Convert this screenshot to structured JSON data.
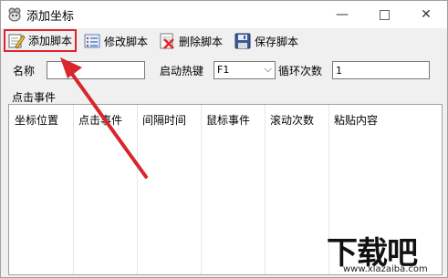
{
  "window": {
    "title": "添加坐标",
    "minimize": "—",
    "close": "✕"
  },
  "toolbar": {
    "add_label": "添加脚本",
    "edit_label": "修改脚本",
    "delete_label": "删除脚本",
    "save_label": "保存脚本"
  },
  "form": {
    "name_label": "名称",
    "name_value": "",
    "hotkey_label": "启动热键",
    "hotkey_value": "F1",
    "loop_label": "循环次数",
    "loop_value": "1"
  },
  "events": {
    "group_label": "点击事件",
    "columns": [
      "坐标位置",
      "点击事件",
      "间隔时间",
      "鼠标事件",
      "滚动次数",
      "粘贴内容"
    ]
  },
  "watermark": {
    "big": "下载吧",
    "url": "www.xiazaiba.com"
  },
  "colors": {
    "highlight": "#e0242a"
  }
}
